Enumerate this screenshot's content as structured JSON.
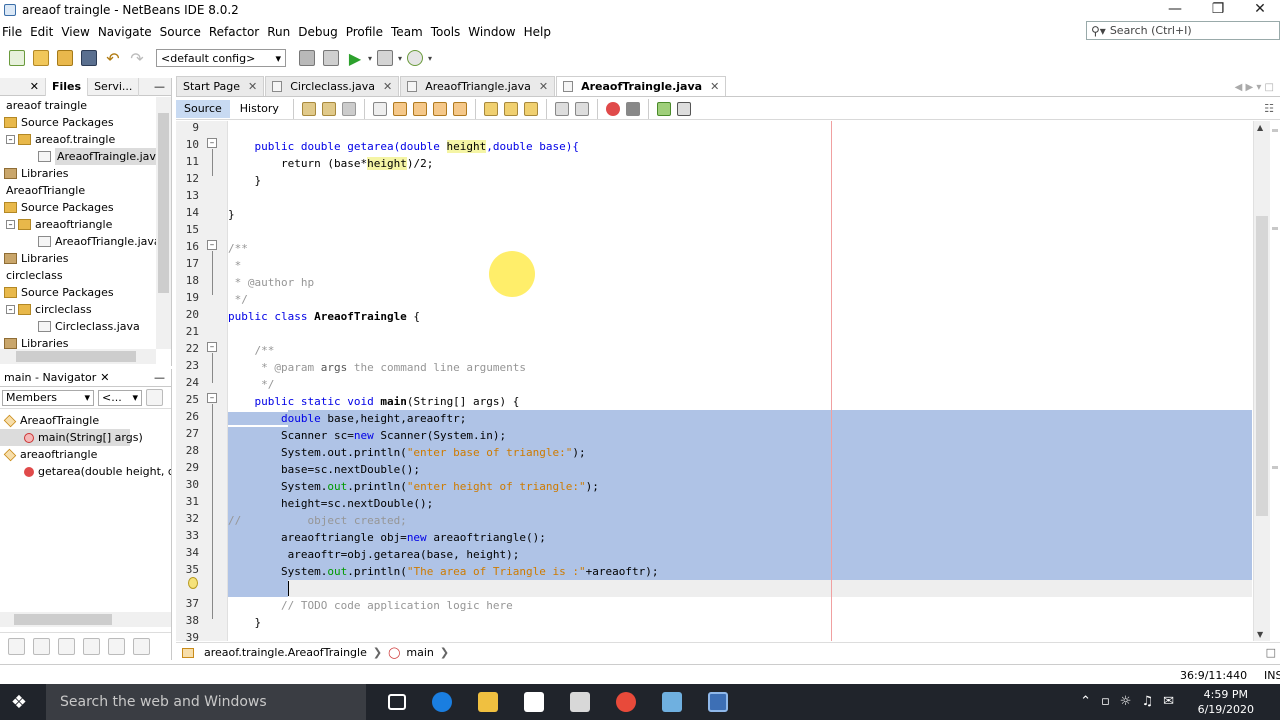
{
  "window": {
    "title": "areaof traingle - NetBeans IDE 8.0.2"
  },
  "menu": [
    "File",
    "Edit",
    "View",
    "Navigate",
    "Source",
    "Refactor",
    "Run",
    "Debug",
    "Profile",
    "Team",
    "Tools",
    "Window",
    "Help"
  ],
  "search": {
    "placeholder": "Search (Ctrl+I)"
  },
  "toolbar": {
    "config": "<default config>"
  },
  "projects_panel": {
    "tabs": [
      "Files",
      "Servi..."
    ],
    "tree": [
      {
        "label": "areaof traingle",
        "type": "project"
      },
      {
        "label": "Source Packages",
        "type": "pkgroot"
      },
      {
        "label": "areaof.traingle",
        "type": "pkg"
      },
      {
        "label": "AreaofTraingle.java",
        "type": "file",
        "selected": true
      },
      {
        "label": "Libraries",
        "type": "lib"
      },
      {
        "label": "AreaofTriangle",
        "type": "project"
      },
      {
        "label": "Source Packages",
        "type": "pkgroot"
      },
      {
        "label": "areaoftriangle",
        "type": "pkg"
      },
      {
        "label": "AreaofTriangle.java",
        "type": "file"
      },
      {
        "label": "Libraries",
        "type": "lib"
      },
      {
        "label": "circleclass",
        "type": "project"
      },
      {
        "label": "Source Packages",
        "type": "pkgroot"
      },
      {
        "label": "circleclass",
        "type": "pkg"
      },
      {
        "label": "Circleclass.java",
        "type": "file"
      },
      {
        "label": "Libraries",
        "type": "lib"
      }
    ]
  },
  "navigator": {
    "title": "main - Navigator",
    "filter": "Members",
    "filter2": "<...",
    "items": [
      {
        "label": "AreaofTraingle"
      },
      {
        "label": "main(String[] args)"
      },
      {
        "label": "areaoftriangle"
      },
      {
        "label": "getarea(double height, doub"
      }
    ]
  },
  "editor": {
    "tabs": [
      {
        "label": "Start Page"
      },
      {
        "label": "Circleclass.java"
      },
      {
        "label": "AreaofTriangle.java"
      },
      {
        "label": "AreaofTraingle.java",
        "active": true
      }
    ],
    "mode_tabs": [
      "Source",
      "History"
    ],
    "line_numbers": [
      "9",
      "10",
      "11",
      "12",
      "13",
      "14",
      "15",
      "16",
      "17",
      "18",
      "19",
      "20",
      "21",
      "22",
      "23",
      "24",
      "25",
      "26",
      "27",
      "28",
      "29",
      "30",
      "31",
      "32",
      "33",
      "34",
      "35",
      "36",
      "37",
      "38",
      "39"
    ],
    "lines": {
      "l10a": "    public double getarea(double ",
      "l10b": "height",
      "l10c": ",double base){",
      "l11a": "        return (base*",
      "l11b": "height",
      ")l11c": ")/2;",
      "l12": "    }",
      "l14": "}",
      "l16": "/**",
      "l17": " *",
      "l18": " * @author hp",
      "l19": " */",
      "l20a": "public class ",
      "l20b": "AreaofTraingle",
      ")l20c": " {",
      "l22": "    /**",
      "l23a": "     * @param ",
      "l23b": "args",
      "l23c": " the command line arguments",
      "l24": "     */",
      "l25a": "    public static void ",
      "l25b": "main",
      "l25c": "(String[] args) {",
      "l26a": "        double ",
      "l26b": "base,height,areaoftr;",
      "l27a": "        Scanner sc=",
      "l27b": "new ",
      "l27c": "Scanner(System.in);",
      "l28a": "        System.out.println(",
      "l28b": "\"enter base of triangle:\"",
      "l28c": ");",
      "l29": "        base=sc.nextDouble();",
      "l30a": "        System.",
      "l30b": "out",
      "l30c": ".println(",
      "l30d": "\"enter height of triangle:\"",
      "l30e": ");",
      "l31": "        height=sc.nextDouble();",
      "l32": "//          object created;",
      "l33a": "        areaoftriangle obj=",
      "l33b": "new ",
      "l33c": "areaoftriangle();",
      "l34": "         areaoftr=obj.getarea(base, height);",
      "l35a": "        System.",
      "l35b": "out",
      "l35c": ".println(",
      "l35d": "\"The area of Triangle is :\"",
      "l35e": "+areaoftr);",
      "l36": "        ",
      "l37": "        // TODO code application logic here",
      "l38": "    }"
    },
    "breadcrumb": [
      "areaof.traingle.AreaofTraingle",
      "main"
    ]
  },
  "status": {
    "position": "36:9/11:440",
    "mode": "INS"
  },
  "taskbar": {
    "search": "Search the web and Windows",
    "time": "4:59 PM",
    "date": "6/19/2020"
  }
}
